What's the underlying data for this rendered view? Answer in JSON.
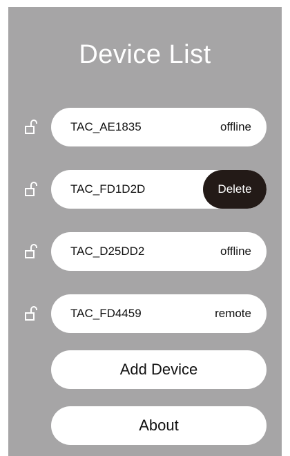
{
  "page": {
    "title": "Device List"
  },
  "devices": [
    {
      "name": "TAC_AE1835",
      "status": "offline",
      "icon": "lock-open-icon"
    },
    {
      "name": "TAC_FD1D2D",
      "status": "",
      "action": "Delete",
      "icon": "lock-open-icon"
    },
    {
      "name": "TAC_D25DD2",
      "status": "offline",
      "icon": "lock-open-icon"
    },
    {
      "name": "TAC_FD4459",
      "status": "remote",
      "icon": "lock-open-icon"
    }
  ],
  "actions": {
    "add_device": "Add Device",
    "about": "About"
  },
  "colors": {
    "background": "#a6a5a6",
    "pill": "#ffffff",
    "delete": "#231a17",
    "title": "#ffffff"
  }
}
